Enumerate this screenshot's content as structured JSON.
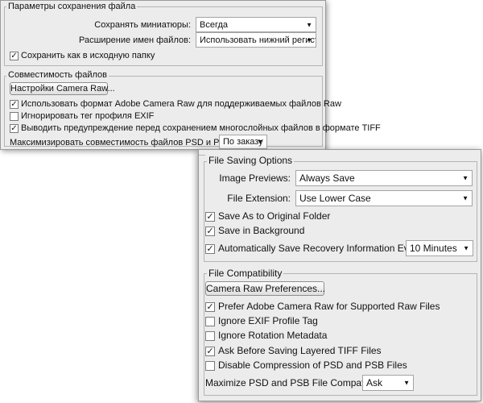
{
  "ru": {
    "saving": {
      "legend": "Параметры сохранения файла",
      "previews_label": "Сохранять миниатюры:",
      "previews_value": "Всегда",
      "ext_label": "Расширение имен файлов:",
      "ext_value": "Использовать нижний регистр",
      "save_original": "Сохранить как в исходную папку"
    },
    "compat": {
      "legend": "Совместимость файлов",
      "camera_raw_button": "Настройки Camera Raw...",
      "opt1": "Использовать формат Adobe Camera Raw для поддерживаемых файлов Raw",
      "opt2": "Игнорировать тег профиля EXIF",
      "opt3": "Выводить предупреждение перед сохранением многослойных файлов в формате TIFF",
      "maximize_label": "Максимизировать совместимость файлов PSD и PSB:",
      "maximize_value": "По заказу"
    }
  },
  "en": {
    "saving": {
      "legend": "File Saving Options",
      "previews_label": "Image Previews:",
      "previews_value": "Always Save",
      "ext_label": "File Extension:",
      "ext_value": "Use Lower Case",
      "save_original": "Save As to Original Folder",
      "save_background": "Save in Background",
      "auto_save": "Automatically Save Recovery Information Every:",
      "auto_save_value": "10 Minutes"
    },
    "compat": {
      "legend": "File Compatibility",
      "camera_raw_button": "Camera Raw Preferences...",
      "opt1": "Prefer Adobe Camera Raw for Supported Raw Files",
      "opt2": "Ignore EXIF Profile Tag",
      "opt3": "Ignore Rotation Metadata",
      "opt4": "Ask Before Saving Layered TIFF Files",
      "opt5": "Disable Compression of PSD and PSB Files",
      "maximize_label": "Maximize PSD and PSB File Compatibility:",
      "maximize_value": "Ask"
    }
  },
  "icons": {
    "check": "✓",
    "dropdown": "▼"
  }
}
